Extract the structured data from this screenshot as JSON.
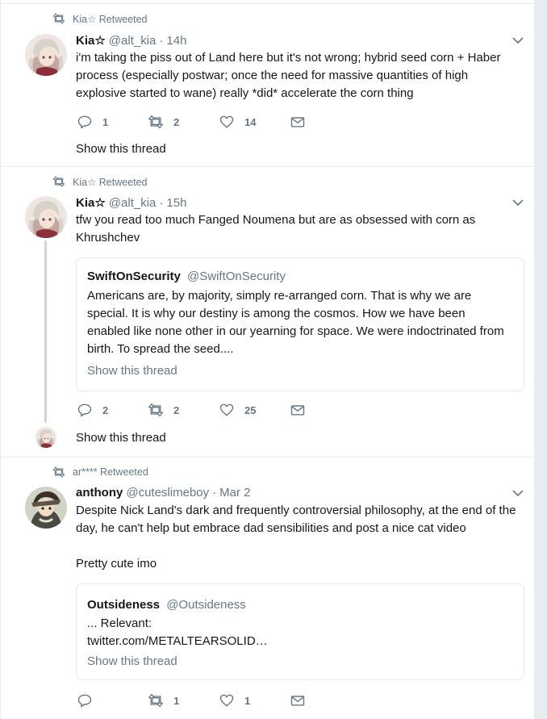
{
  "colors": {
    "background": "#e6ecf0",
    "card": "#ffffff",
    "secondary_text": "#657786",
    "primary_text": "#14171a"
  },
  "tweets": [
    {
      "retweeted_by": "Kia☆ Retweeted",
      "name": "Kia☆",
      "handle": "@alt_kia",
      "separator": "·",
      "time": "14h",
      "text": "i'm taking the piss out of Land here but it's not wrong; hybrid seed corn + Haber process (especially postwar; once the need for massive quantities of high explosive started to wane) really *did* accelerate the corn thing",
      "replies": "1",
      "retweets": "2",
      "likes": "14",
      "show_thread": "Show this thread"
    },
    {
      "retweeted_by": "Kia☆ Retweeted",
      "name": "Kia☆",
      "handle": "@alt_kia",
      "separator": "·",
      "time": "15h",
      "text": "tfw you read too much Fanged Noumena but are as obsessed with corn as Khrushchev",
      "quote": {
        "name": "SwiftOnSecurity",
        "handle": "@SwiftOnSecurity",
        "text": "Americans are, by majority, simply re-arranged corn. That is why we are special. It is why our destiny is among the cosmos. How we have been enabled like none other in our yearning for space. We were indoctrinated from birth. To spread the seed....",
        "show_thread": "Show this thread"
      },
      "replies": "2",
      "retweets": "2",
      "likes": "25",
      "show_thread": "Show this thread"
    },
    {
      "retweeted_by": "ar**** Retweeted",
      "name": "anthony",
      "handle": "@cuteslimeboy",
      "separator": "·",
      "time": "Mar 2",
      "text": "Despite Nick Land's dark and frequently controversial philosophy, at the end of the day, he can't help but embrace dad sensibilities and post a nice cat video",
      "text2": "Pretty cute imo",
      "quote": {
        "name": "Outsideness",
        "handle": "@Outsideness",
        "line1": "... Relevant:",
        "line2": "twitter.com/METALTEARSOLID…",
        "show_thread": "Show this thread"
      },
      "replies": "",
      "retweets": "1",
      "likes": "1"
    }
  ]
}
